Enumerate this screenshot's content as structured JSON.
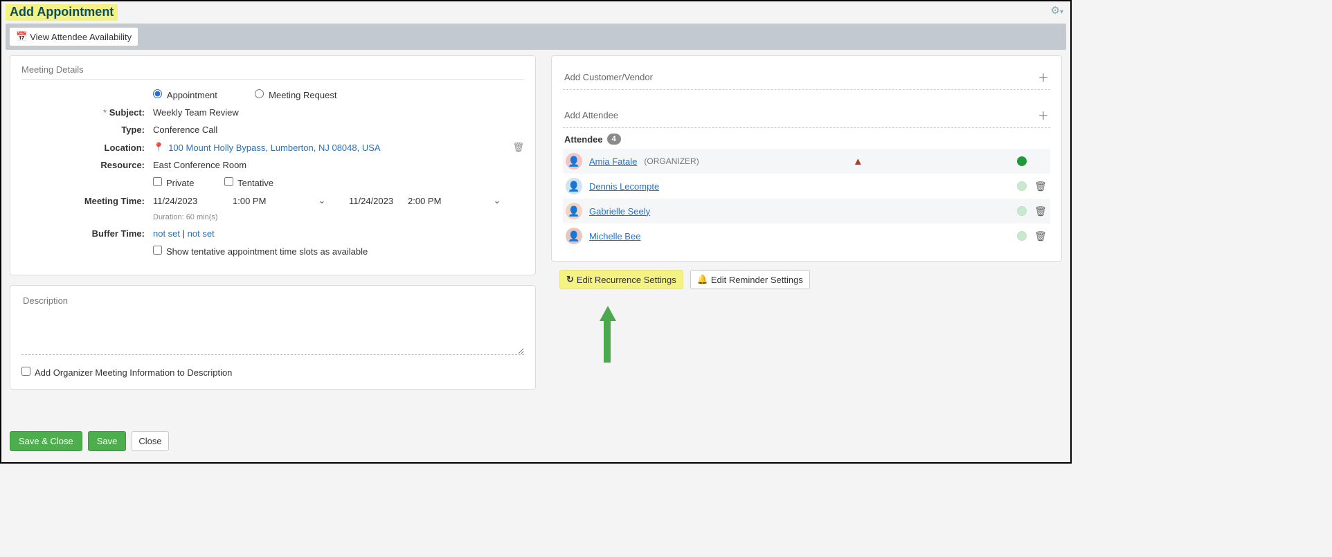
{
  "header": {
    "title": "Add Appointment"
  },
  "toolbar": {
    "view_avail": "View Attendee Availability"
  },
  "details": {
    "heading": "Meeting Details",
    "type_radio": {
      "appointment": "Appointment",
      "request": "Meeting Request"
    },
    "labels": {
      "subject": "Subject:",
      "type": "Type:",
      "location": "Location:",
      "resource": "Resource:",
      "meeting_time": "Meeting Time:",
      "buffer_time": "Buffer Time:"
    },
    "subject": "Weekly Team Review",
    "type": "Conference Call",
    "location": "100 Mount Holly Bypass, Lumberton, NJ 08048, USA",
    "resource": "East Conference Room",
    "private": "Private",
    "tentative": "Tentative",
    "time": {
      "start_date": "11/24/2023",
      "start_time": "1:00 PM",
      "end_date": "11/24/2023",
      "end_time": "2:00 PM",
      "duration": "Duration: 60 min(s)"
    },
    "buffer": {
      "a": "not set",
      "b": "not set",
      "sep": " | "
    },
    "show_tentative": "Show tentative appointment time slots as available"
  },
  "desc": {
    "label": "Description",
    "add_org": "Add Organizer Meeting Information to Description"
  },
  "right": {
    "add_cv": "Add Customer/Vendor",
    "add_att": "Add Attendee",
    "att_heading": "Attendee",
    "att_count": "4",
    "attendees": [
      {
        "name": "Amia Fatale",
        "org": "(ORGANIZER)",
        "avatar_color": "#f2c6c6",
        "warn": true,
        "solid": true,
        "trash": false
      },
      {
        "name": "Dennis Lecompte",
        "org": "",
        "avatar_color": "#cde4f5",
        "warn": false,
        "solid": false,
        "trash": true
      },
      {
        "name": "Gabrielle Seely",
        "org": "",
        "avatar_color": "#efd5c2",
        "warn": false,
        "solid": false,
        "trash": true
      },
      {
        "name": "Michelle Bee",
        "org": "",
        "avatar_color": "#e6c7c0",
        "warn": false,
        "solid": false,
        "trash": true
      }
    ],
    "recurrence": "Edit Recurrence Settings",
    "reminder": "Edit Reminder Settings"
  },
  "footer": {
    "save_close": "Save & Close",
    "save": "Save",
    "close": "Close"
  }
}
